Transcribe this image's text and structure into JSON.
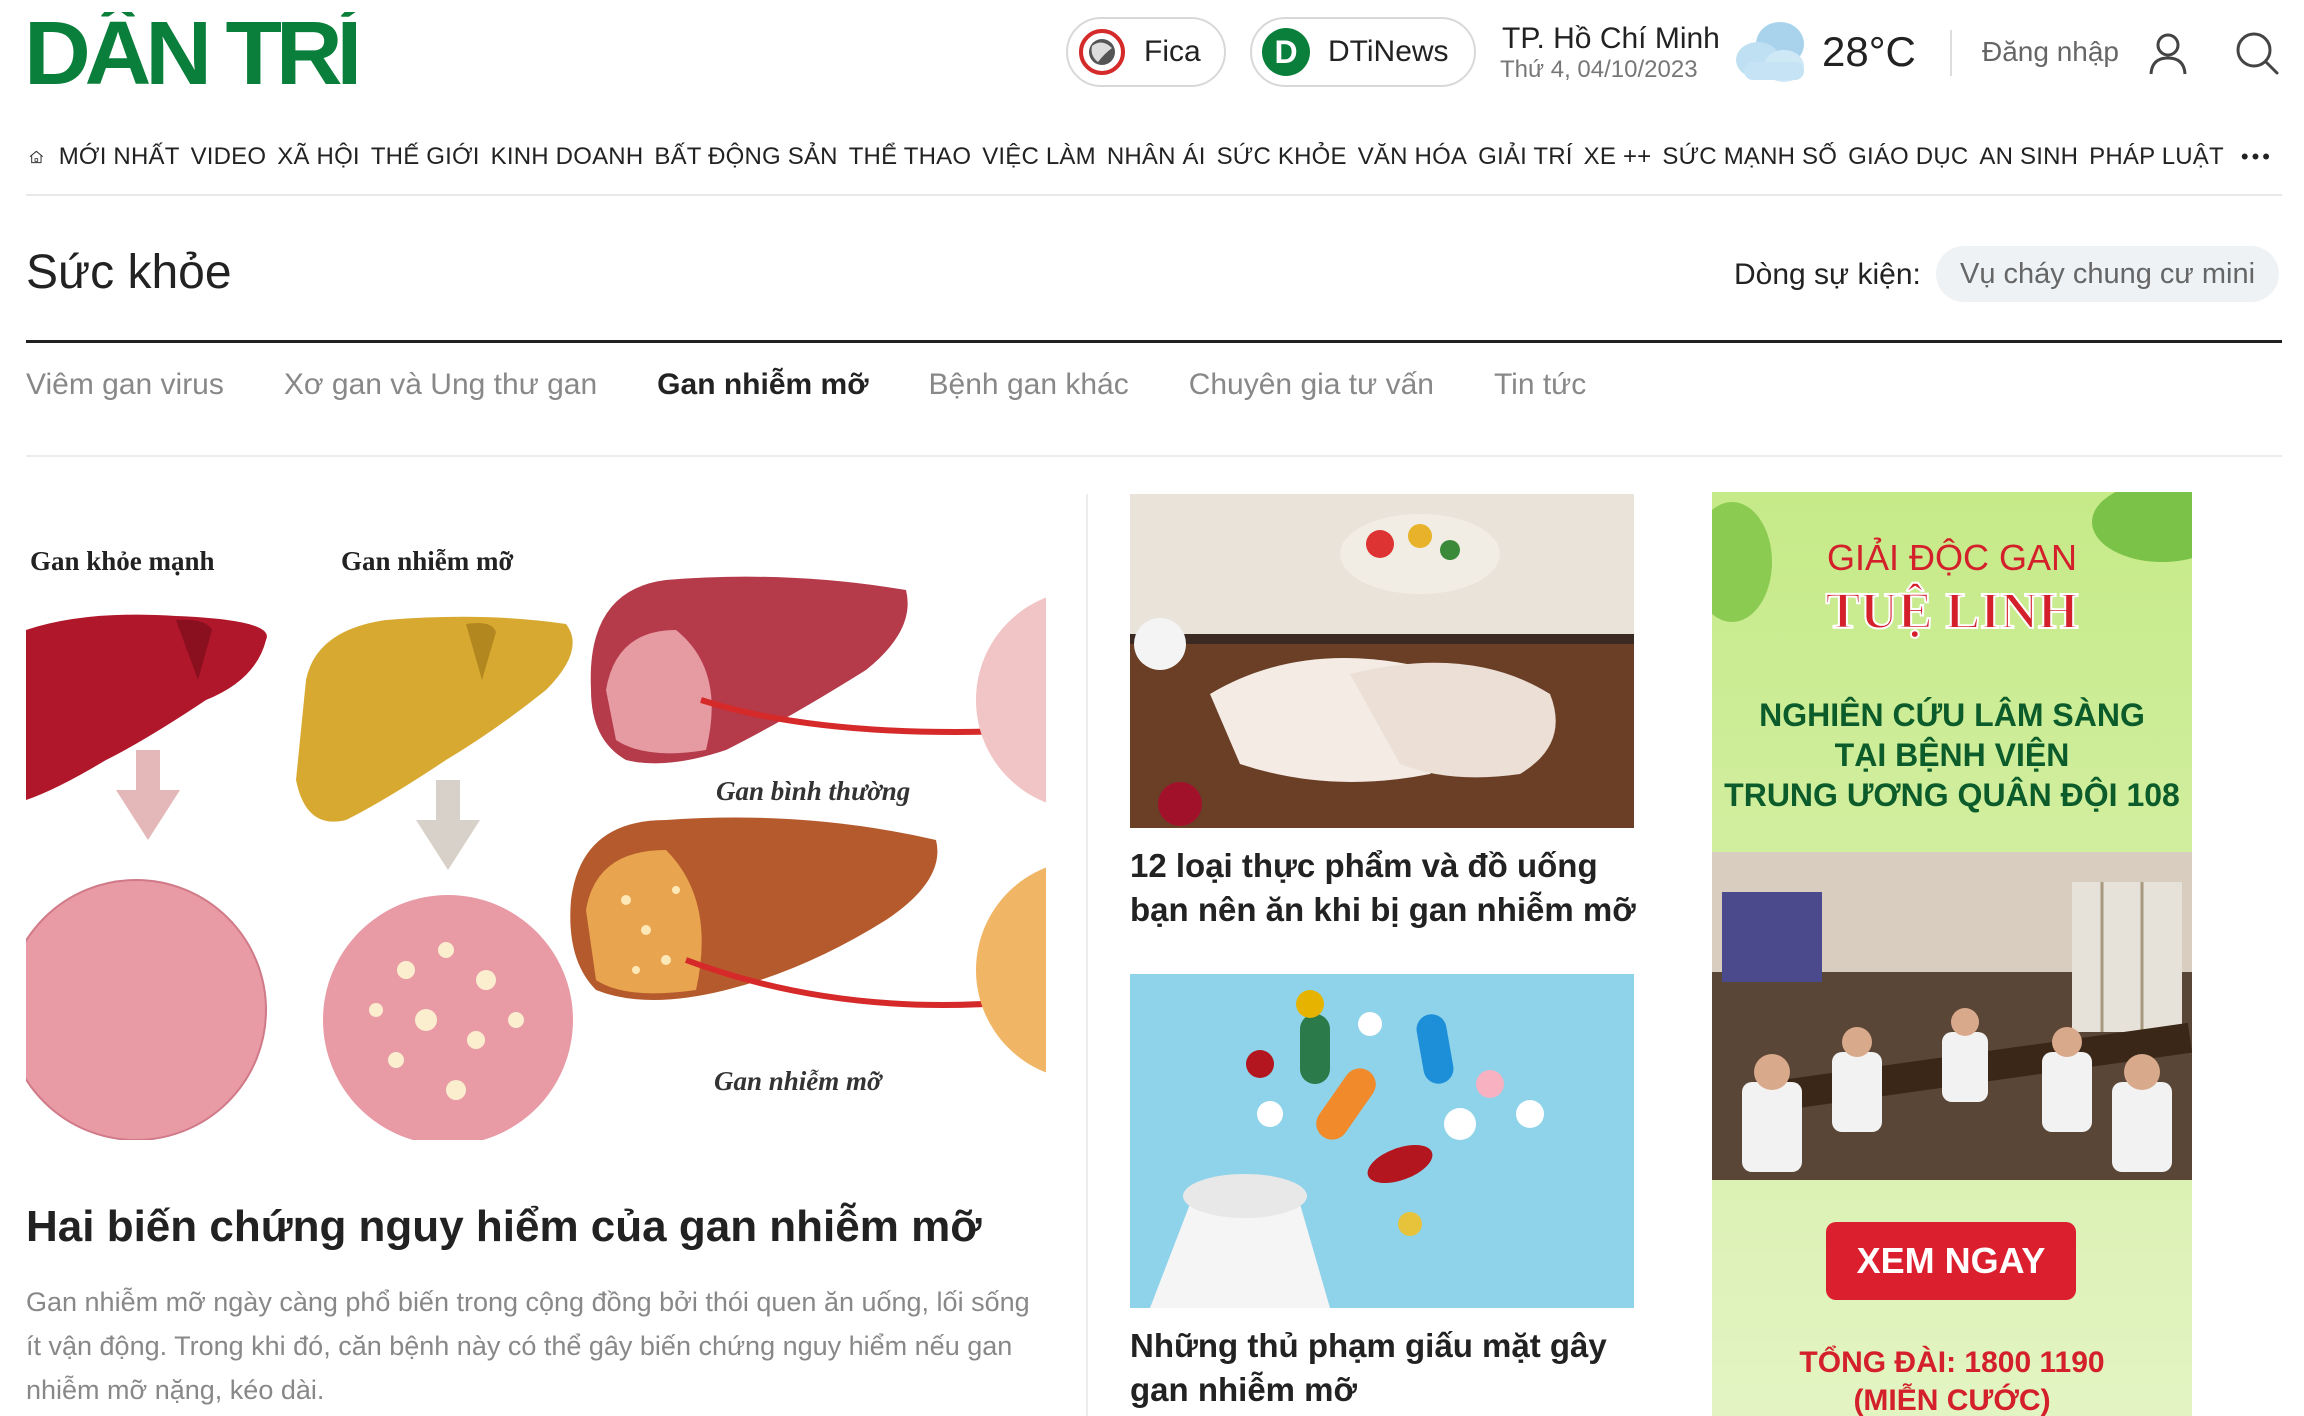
{
  "header": {
    "logo": "DÂN TRÍ",
    "fica": "Fica",
    "dtinews": "DTiNews",
    "city": "TP. Hồ Chí Minh",
    "date": "Thứ 4, 04/10/2023",
    "temperature": "28°C",
    "login": "Đăng nhập",
    "weather_icon": "cloud-icon",
    "user_icon": "user-icon",
    "search_icon": "search-icon"
  },
  "nav": {
    "items": [
      "MỚI NHẤT",
      "VIDEO",
      "XÃ HỘI",
      "THẾ GIỚI",
      "KINH DOANH",
      "BẤT ĐỘNG SẢN",
      "THỂ THAO",
      "VIỆC LÀM",
      "NHÂN ÁI",
      "SỨC KHỎE",
      "VĂN HÓA",
      "GIẢI TRÍ",
      "XE ++",
      "SỨC MẠNH SỐ",
      "GIÁO DỤC",
      "AN SINH",
      "PHÁP LUẬT"
    ],
    "more": "•••"
  },
  "section": {
    "title": "Sức khỏe",
    "event_label": "Dòng sự kiện:",
    "event_chip": "Vụ cháy chung cư mini"
  },
  "subnav": [
    {
      "label": "Viêm gan virus",
      "active": false
    },
    {
      "label": "Xơ gan và Ung thư gan",
      "active": false
    },
    {
      "label": "Gan nhiễm mỡ",
      "active": true
    },
    {
      "label": "Bệnh gan khác",
      "active": false
    },
    {
      "label": "Chuyên gia tư vấn",
      "active": false
    },
    {
      "label": "Tin tức",
      "active": false
    }
  ],
  "main_article": {
    "illustration": {
      "healthy": "Gan khỏe mạnh",
      "fatty": "Gan nhiễm mỡ",
      "normal_caption": "Gan bình thường",
      "fatty_caption": "Gan nhiễm mỡ"
    },
    "title": "Hai biến chứng nguy hiểm của gan nhiễm mỡ",
    "sapo": "Gan nhiễm mỡ ngày càng phổ biến trong cộng đồng bởi thói quen ăn uống, lối sống ít vận động. Trong khi đó, căn bệnh này có thể gây biến chứng nguy hiểm nếu gan nhiễm mỡ nặng, kéo dài."
  },
  "side_articles": [
    {
      "title": "12 loại thực phẩm và đồ uống bạn nên ăn khi bị gan nhiễm mỡ"
    },
    {
      "title": "Những thủ phạm giấu mặt gây gan nhiễm mỡ"
    }
  ],
  "ad": {
    "line1": "GIẢI ĐỘC GAN",
    "brand": "TUỆ LINH",
    "research": [
      "NGHIÊN CỨU LÂM SÀNG",
      "TẠI BỆNH VIỆN",
      "TRUNG ƯƠNG QUÂN ĐỘI 108"
    ],
    "cta": "XEM NGAY",
    "hotline": "TỔNG ĐÀI: 1800 1190",
    "free": "(MIỄN CƯỚC)"
  },
  "colors": {
    "brand_green": "#0a7f3b",
    "ad_red": "#dc1f2e",
    "text": "#222222",
    "muted": "#888888"
  }
}
